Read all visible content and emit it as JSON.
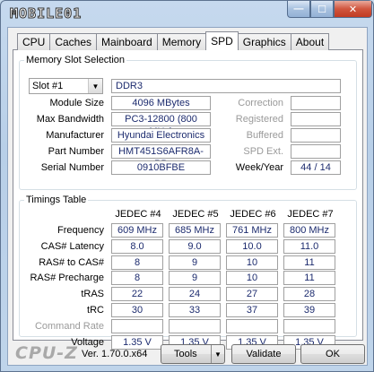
{
  "titlebar": {
    "logo_text": "MOBILE01",
    "min_glyph": "—",
    "max_glyph": "☐",
    "close_glyph": "✕"
  },
  "tabs": [
    "CPU",
    "Caches",
    "Mainboard",
    "Memory",
    "SPD",
    "Graphics",
    "About"
  ],
  "active_tab": "SPD",
  "memory_slot": {
    "group_title": "Memory Slot Selection",
    "selected_slot": "Slot #1",
    "type": "DDR3",
    "rows": [
      {
        "label": "Module Size",
        "value": "4096 MBytes"
      },
      {
        "label": "Max Bandwidth",
        "value": "PC3-12800 (800 MHz)"
      },
      {
        "label": "Manufacturer",
        "value": "Hyundai Electronics"
      },
      {
        "label": "Part Number",
        "value": "HMT451S6AFR8A-PB"
      },
      {
        "label": "Serial Number",
        "value": "0910BFBE"
      }
    ],
    "right_rows": [
      {
        "label": "Correction",
        "value": ""
      },
      {
        "label": "Registered",
        "value": ""
      },
      {
        "label": "Buffered",
        "value": ""
      },
      {
        "label": "SPD Ext.",
        "value": ""
      }
    ],
    "week_year_label": "Week/Year",
    "week_year_value": "44 / 14"
  },
  "timings": {
    "group_title": "Timings Table",
    "columns": [
      "JEDEC #4",
      "JEDEC #5",
      "JEDEC #6",
      "JEDEC #7"
    ],
    "rows": [
      {
        "label": "Frequency",
        "values": [
          "609 MHz",
          "685 MHz",
          "761 MHz",
          "800 MHz"
        ],
        "dim": false
      },
      {
        "label": "CAS# Latency",
        "values": [
          "8.0",
          "9.0",
          "10.0",
          "11.0"
        ],
        "dim": false
      },
      {
        "label": "RAS# to CAS#",
        "values": [
          "8",
          "9",
          "10",
          "11"
        ],
        "dim": false
      },
      {
        "label": "RAS# Precharge",
        "values": [
          "8",
          "9",
          "10",
          "11"
        ],
        "dim": false
      },
      {
        "label": "tRAS",
        "values": [
          "22",
          "24",
          "27",
          "28"
        ],
        "dim": false
      },
      {
        "label": "tRC",
        "values": [
          "30",
          "33",
          "37",
          "39"
        ],
        "dim": false
      },
      {
        "label": "Command Rate",
        "values": [
          "",
          "",
          "",
          ""
        ],
        "dim": true
      },
      {
        "label": "Voltage",
        "values": [
          "1.35 V",
          "1.35 V",
          "1.35 V",
          "1.35 V"
        ],
        "dim": false
      }
    ]
  },
  "footer": {
    "brand": "CPU-Z",
    "version": "Ver. 1.70.0.x64",
    "tools_label": "Tools",
    "validate_label": "Validate",
    "ok_label": "OK"
  }
}
